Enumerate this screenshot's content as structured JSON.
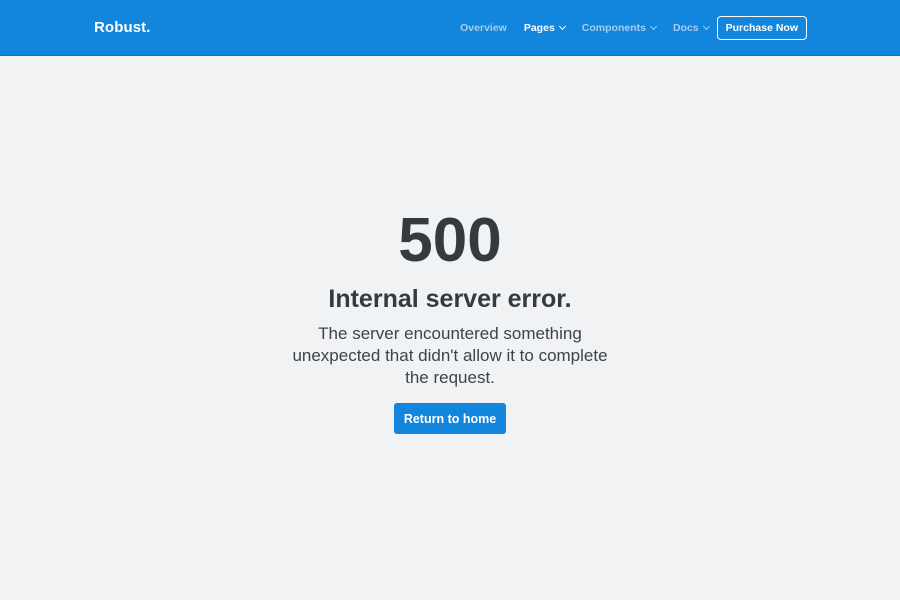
{
  "navbar": {
    "brand": "Robust.",
    "items": [
      {
        "label": "Overview",
        "active": false,
        "dropdown": false
      },
      {
        "label": "Pages",
        "active": true,
        "dropdown": true
      },
      {
        "label": "Components",
        "active": false,
        "dropdown": true
      },
      {
        "label": "Docs",
        "active": false,
        "dropdown": true
      }
    ],
    "purchase_label": "Purchase Now"
  },
  "error": {
    "code": "500",
    "title": "Internal server error.",
    "description": "The server encountered something unexpected that didn't allow it to complete the request.",
    "button_label": "Return to home"
  },
  "colors": {
    "brand_blue": "#1286dd",
    "background": "#f1f2f4",
    "text_dark": "#343a40",
    "nav_inactive": "#a9cdf0"
  }
}
